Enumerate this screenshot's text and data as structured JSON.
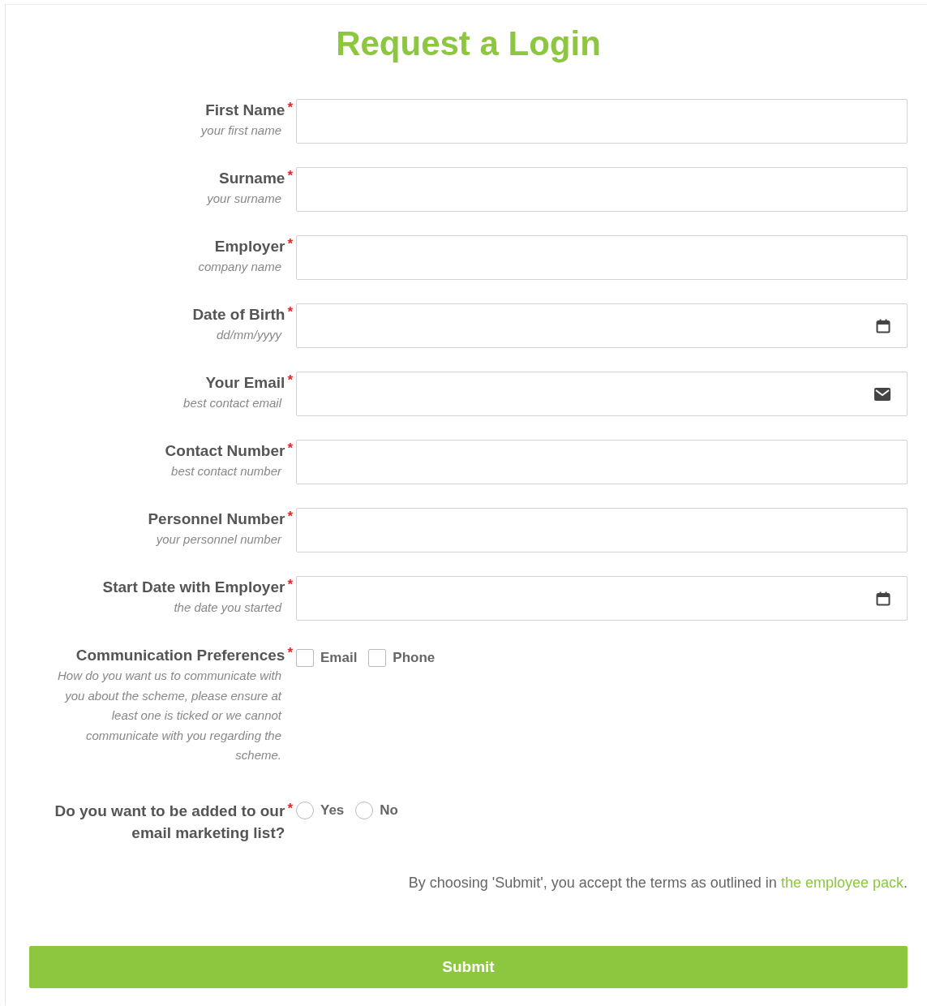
{
  "title": "Request a Login",
  "fields": [
    {
      "kind": "text",
      "label": "First Name",
      "required_mark": "*",
      "hint": "your first name"
    },
    {
      "kind": "text",
      "label": "Surname",
      "required_mark": "*",
      "hint": "your surname"
    },
    {
      "kind": "text",
      "label": "Employer",
      "required_mark": "*",
      "hint": "company name"
    },
    {
      "kind": "date",
      "label": "Date of Birth",
      "required_mark": "*",
      "hint": "dd/mm/yyyy"
    },
    {
      "kind": "email",
      "label": "Your Email",
      "required_mark": "*",
      "hint": "best contact email"
    },
    {
      "kind": "text",
      "label": "Contact Number",
      "required_mark": "*",
      "hint": "best contact number"
    },
    {
      "kind": "text",
      "label": "Personnel Number",
      "required_mark": "*",
      "hint": "your personnel number"
    },
    {
      "kind": "date",
      "label": "Start Date with Employer",
      "required_mark": "*",
      "hint": "the date you started"
    },
    {
      "kind": "checkboxes",
      "label": "Communication Preferences",
      "required_mark": "*",
      "hint": "How do you want us to communicate with you about the scheme, please ensure at least one is ticked or we cannot communicate with you regarding the scheme.",
      "options": [
        {
          "label": "Email",
          "checked": false
        },
        {
          "label": "Phone",
          "checked": false
        }
      ]
    },
    {
      "kind": "radios",
      "label": "Do you want to be added to our email marketing list?",
      "required_mark": "*",
      "options": [
        {
          "label": "Yes",
          "selected": false
        },
        {
          "label": "No",
          "selected": false
        }
      ]
    }
  ],
  "terms": {
    "text": "By choosing 'Submit', you accept the terms as outlined in ",
    "link": "the employee pack",
    "end": "."
  },
  "submit": "Submit"
}
